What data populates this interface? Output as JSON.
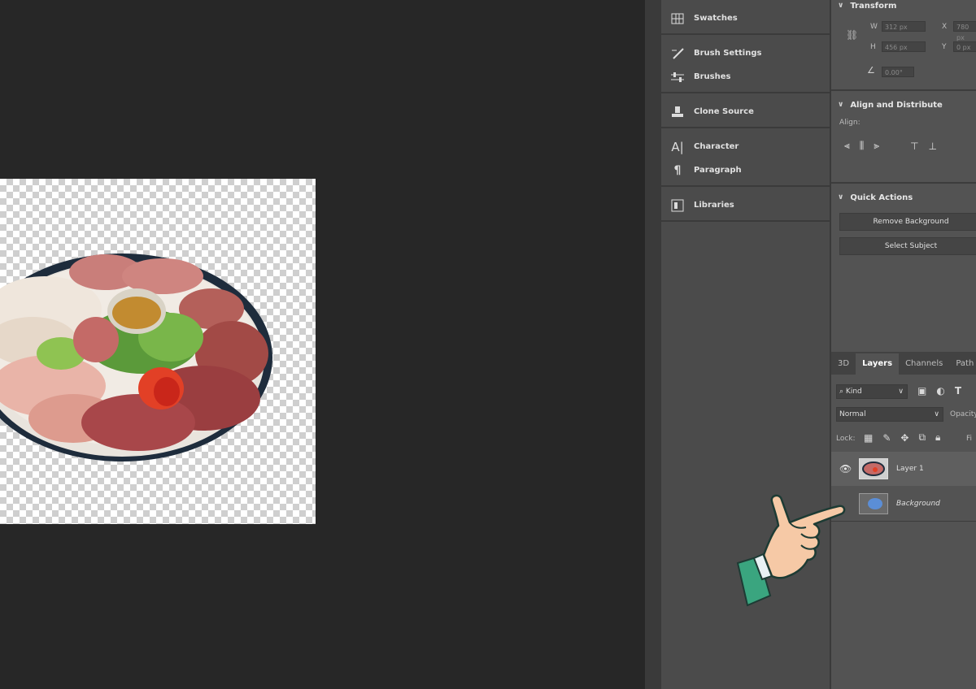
{
  "dock": {
    "items": [
      {
        "label": "Swatches",
        "icon": "grid-icon"
      },
      {
        "label": "Brush Settings",
        "icon": "brush-settings-icon"
      },
      {
        "label": "Brushes",
        "icon": "sliders-icon"
      },
      {
        "label": "Clone Source",
        "icon": "stamp-icon"
      },
      {
        "label": "Character",
        "icon": "type-char-icon"
      },
      {
        "label": "Paragraph",
        "icon": "pilcrow-icon"
      },
      {
        "label": "Libraries",
        "icon": "library-icon"
      }
    ]
  },
  "properties": {
    "transform": {
      "title": "Transform",
      "w_label": "W",
      "w_value": "312 px",
      "h_label": "H",
      "h_value": "456 px",
      "x_label": "X",
      "x_value": "780 px",
      "y_label": "Y",
      "y_value": "0 px",
      "angle_value": "0.00°"
    },
    "align": {
      "title": "Align and Distribute",
      "sub": "Align:"
    },
    "quick": {
      "title": "Quick Actions",
      "btn1": "Remove Background",
      "btn2": "Select Subject"
    }
  },
  "layers_panel": {
    "tabs": [
      "3D",
      "Layers",
      "Channels",
      "Path"
    ],
    "active_tab": "Layers",
    "filter_kind": "Kind",
    "blend_mode": "Normal",
    "opacity_label": "Opacity",
    "lock_label": "Lock:",
    "fill_label": "Fi",
    "layers": [
      {
        "name": "Layer 1",
        "visible": true
      },
      {
        "name": "Background",
        "visible": false
      }
    ]
  },
  "colors": {
    "canvas_bg": "#272727",
    "panel_bg": "#535353",
    "dock_bg": "#4b4b4b",
    "hand_skin": "#f6c9a6",
    "sleeve": "#3aa57f"
  }
}
